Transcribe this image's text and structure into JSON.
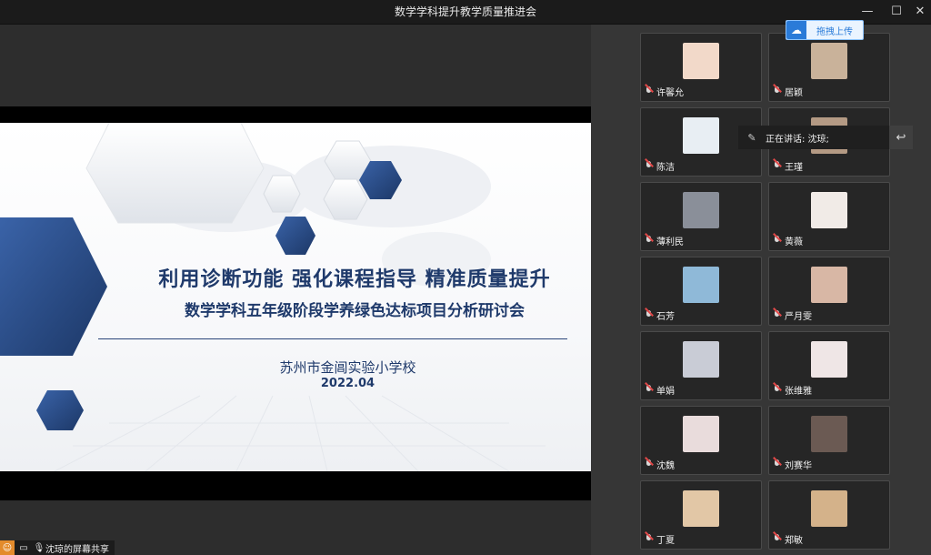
{
  "window": {
    "title": "数学学科提升教学质量推进会",
    "controls": {
      "minimize": "—",
      "maximize": "☐",
      "close": "✕"
    }
  },
  "slide": {
    "title_line": "利用诊断功能  强化课程指导  精准质量提升",
    "subtitle_line": "数学学科五年级阶段学养绿色达标项目分析研讨会",
    "school": "苏州市金阊实验小学校",
    "date": "2022.04",
    "colors": {
      "navy": "#1f3a6b",
      "hex_blue": "#2a4f8f"
    }
  },
  "share_status": {
    "label": "沈琼的屏幕共享",
    "icons": [
      "person-icon",
      "screen-icon",
      "mic-icon"
    ]
  },
  "upload_button": {
    "label": "拖拽上传",
    "icon": "cloud-icon"
  },
  "speaking_bar": {
    "label": "正在讲话: 沈琼;",
    "icon": "mic-muted-icon",
    "reply_icon": "reply-icon"
  },
  "participants": [
    {
      "name": "许馨允"
    },
    {
      "name": "居颖"
    },
    {
      "name": "陈洁"
    },
    {
      "name": "王瑾"
    },
    {
      "name": "薄利民"
    },
    {
      "name": "黄薇"
    },
    {
      "name": "石芳"
    },
    {
      "name": "严月雯"
    },
    {
      "name": "单娟"
    },
    {
      "name": "张维雅"
    },
    {
      "name": "沈魏"
    },
    {
      "name": "刘赛华"
    },
    {
      "name": "丁夏"
    },
    {
      "name": "郑敏"
    }
  ]
}
